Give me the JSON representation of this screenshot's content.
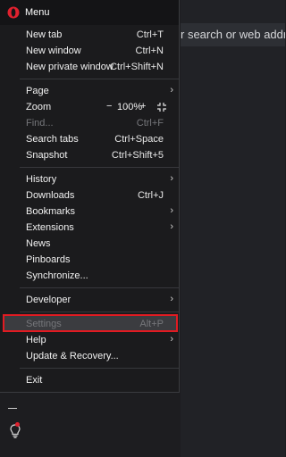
{
  "address_bar": {
    "placeholder": "r search or web address"
  },
  "menu": {
    "title": "Menu",
    "items": {
      "new_tab": {
        "label": "New tab",
        "shortcut": "Ctrl+T"
      },
      "new_window": {
        "label": "New window",
        "shortcut": "Ctrl+N"
      },
      "new_private_window": {
        "label": "New private window",
        "shortcut": "Ctrl+Shift+N"
      },
      "page": {
        "label": "Page"
      },
      "zoom": {
        "label": "Zoom",
        "minus": "−",
        "value": "100%",
        "plus": "+"
      },
      "find": {
        "label": "Find...",
        "shortcut": "Ctrl+F"
      },
      "search_tabs": {
        "label": "Search tabs",
        "shortcut": "Ctrl+Space"
      },
      "snapshot": {
        "label": "Snapshot",
        "shortcut": "Ctrl+Shift+5"
      },
      "history": {
        "label": "History"
      },
      "downloads": {
        "label": "Downloads",
        "shortcut": "Ctrl+J"
      },
      "bookmarks": {
        "label": "Bookmarks"
      },
      "extensions": {
        "label": "Extensions"
      },
      "news": {
        "label": "News"
      },
      "pinboards": {
        "label": "Pinboards"
      },
      "synchronize": {
        "label": "Synchronize..."
      },
      "developer": {
        "label": "Developer"
      },
      "settings": {
        "label": "Settings",
        "shortcut": "Alt+P"
      },
      "help": {
        "label": "Help"
      },
      "update_recovery": {
        "label": "Update & Recovery..."
      },
      "exit": {
        "label": "Exit"
      }
    },
    "chevron": "›"
  },
  "colors": {
    "highlight": "#e11b22",
    "opera_red": "#e0212e"
  }
}
